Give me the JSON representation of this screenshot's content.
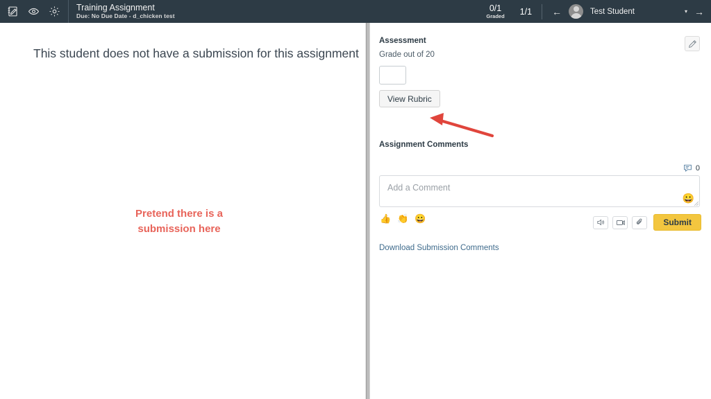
{
  "topbar": {
    "icons": [
      {
        "name": "assignment-icon",
        "label": "Assignment"
      },
      {
        "name": "eye-icon",
        "label": "Preview"
      },
      {
        "name": "gear-icon",
        "label": "Settings"
      }
    ],
    "assignment_title": "Training Assignment",
    "assignment_subtitle": "Due: No Due Date - d_chicken test",
    "graded_count": "0/1",
    "graded_label": "Graded",
    "position": "1/1",
    "prev_arrow": "←",
    "next_arrow": "→",
    "student_name": "Test Student",
    "student_caret": "▾"
  },
  "left_pane": {
    "no_submission_message": "This student does not have a submission for this assignment",
    "annotation_line1": "Pretend there is a",
    "annotation_line2": "submission here",
    "annotation_color": "#e8645a"
  },
  "assessment": {
    "heading": "Assessment",
    "edit_icon": "pencil-icon",
    "grade_label": "Grade out of 20",
    "grade_value": "",
    "grade_placeholder": "",
    "view_rubric_label": "View Rubric",
    "arrow_color": "#e0453c"
  },
  "comments": {
    "heading": "Assignment Comments",
    "count_icon": "comment-bubble-icon",
    "count": "0",
    "comment_placeholder": "Add a Comment",
    "comment_value": "",
    "emoji_picker_icon": "😀",
    "quick_reactions": [
      "👍",
      "👏",
      "😀"
    ],
    "action_icons": [
      {
        "name": "audio-comment-icon"
      },
      {
        "name": "video-comment-icon"
      },
      {
        "name": "attachment-icon"
      }
    ],
    "submit_label": "Submit",
    "submit_color": "#f3c63f",
    "download_link": "Download Submission Comments"
  }
}
